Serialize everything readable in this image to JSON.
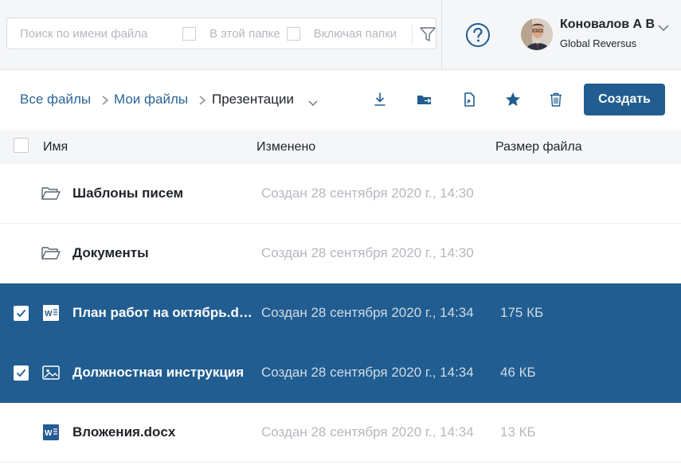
{
  "search": {
    "placeholder": "Поиск по имени файла",
    "in_folder_label": "В этой папке",
    "include_folders_label": "Включая папки"
  },
  "user": {
    "name": "Коновалов А В",
    "company": "Global Reversus"
  },
  "breadcrumb": {
    "items": [
      "Все файлы",
      "Мои файлы"
    ],
    "current": "Презентации"
  },
  "toolbar": {
    "create_label": "Создать"
  },
  "table": {
    "columns": [
      "Имя",
      "Изменено",
      "Размер файла"
    ],
    "rows": [
      {
        "name": "Шаблоны писем",
        "modified": "Создан 28 сентября 2020 г., 14:30",
        "size": "",
        "type": "folder-icon",
        "selected": false
      },
      {
        "name": "Документы",
        "modified": "Создан 28 сентября 2020 г., 14:30",
        "size": "",
        "type": "folder-icon",
        "selected": false
      },
      {
        "name": "План работ на октябрь.docx",
        "modified": "Создан 28 сентября 2020 г., 14:34",
        "size": "175 КБ",
        "type": "word-doc-icon",
        "selected": true
      },
      {
        "name": "Должностная инструкция",
        "modified": "Создан 28 сентября 2020 г., 14:34",
        "size": "46 КБ",
        "type": "image-file-icon",
        "selected": true
      },
      {
        "name": "Вложения.docx",
        "modified": "Создан 28 сентября 2020 г., 14:34",
        "size": "13 КБ",
        "type": "word-doc-icon",
        "selected": false
      }
    ]
  },
  "colors": {
    "accent": "#215d90",
    "link": "#2a6496",
    "muted_text": "#b4b8bf",
    "header_bg": "#f5f6f8"
  }
}
